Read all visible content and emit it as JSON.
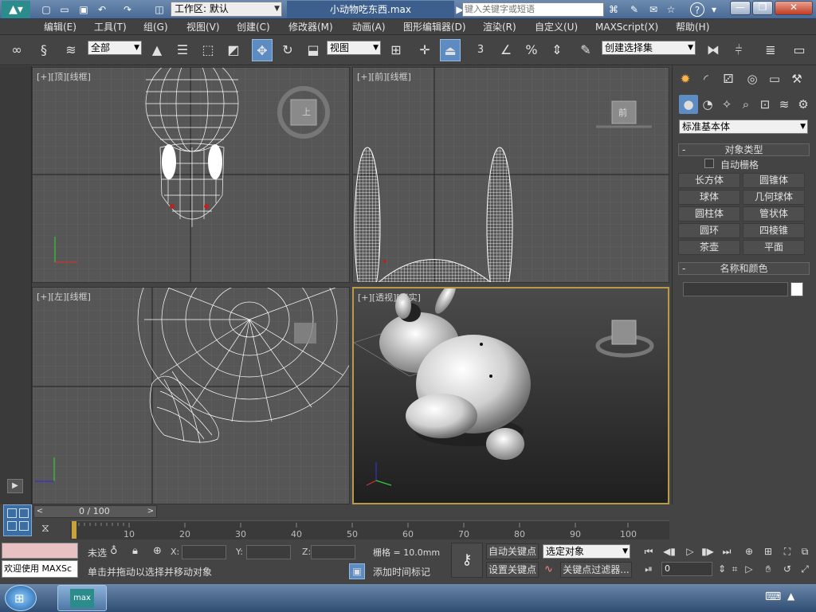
{
  "titlebar": {
    "workspace_label": "工作区: 默认",
    "doc_title": "小动物吃东西.max",
    "search_placeholder": "键入关键字或短语"
  },
  "menubar": {
    "items": [
      "编辑(E)",
      "工具(T)",
      "组(G)",
      "视图(V)",
      "创建(C)",
      "修改器(M)",
      "动画(A)",
      "图形编辑器(D)",
      "渲染(R)",
      "自定义(U)",
      "MAXScript(X)",
      "帮助(H)"
    ]
  },
  "toolbar": {
    "selection_filter": "全部",
    "ref_coord": "视图",
    "named_selection": "创建选择集",
    "snap_3": "3",
    "snap_pct": "%"
  },
  "viewports": {
    "top": {
      "label": "[+][顶][线框]"
    },
    "front": {
      "label": "[+][前][线框]"
    },
    "left": {
      "label": "[+][左][线框]"
    },
    "persp": {
      "label": "[+][透视][真实]"
    },
    "cube_top": "上",
    "cube_front": "前"
  },
  "command_panel": {
    "category": "标准基本体",
    "object_type_header": "对象类型",
    "autogrid_label": "自动栅格",
    "objects": [
      "长方体",
      "圆锥体",
      "球体",
      "几何球体",
      "圆柱体",
      "管状体",
      "圆环",
      "四棱锥",
      "茶壶",
      "平面"
    ],
    "name_color_header": "名称和颜色"
  },
  "timeline": {
    "slider_label": "0 / 100",
    "ticks": [
      "10",
      "20",
      "30",
      "40",
      "50",
      "60",
      "70",
      "80",
      "90",
      "100"
    ]
  },
  "status": {
    "maxscript_welcome": "欢迎使用 MAXSc",
    "selection_lock": "未选",
    "x_label": "X:",
    "y_label": "Y:",
    "z_label": "Z:",
    "grid": "栅格 = 10.0mm",
    "prompt": "单击并拖动以选择并移动对象",
    "add_time_tag": "添加时间标记",
    "auto_key": "自动关键点",
    "set_key": "设置关键点",
    "key_filter_sel": "选定对象",
    "key_filters": "关键点过滤器...",
    "frame": "0"
  },
  "colors": {
    "accent": "#5d8cc2",
    "persp_border": "#b89a4a",
    "red_swatch": "#e8c2c2"
  }
}
